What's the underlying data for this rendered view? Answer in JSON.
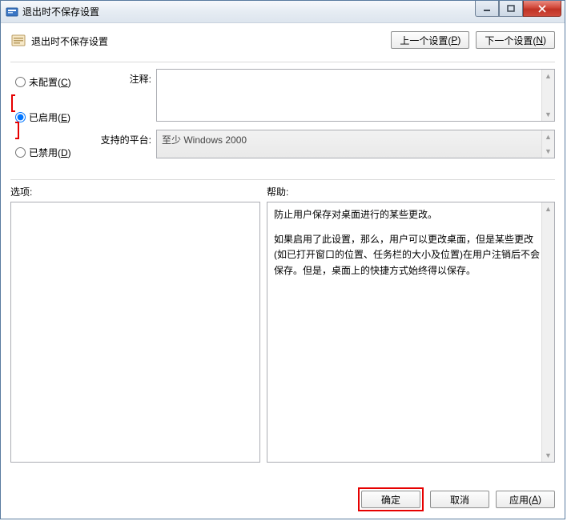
{
  "titlebar": {
    "title": "退出时不保存设置"
  },
  "header": {
    "policy_title": "退出时不保存设置",
    "prev_label": "上一个设置(",
    "prev_key": "P",
    "prev_tail": ")",
    "next_label": "下一个设置(",
    "next_key": "N",
    "next_tail": ")"
  },
  "radio": {
    "not_configured": "未配置(",
    "not_configured_key": "C",
    "enabled": "已启用(",
    "enabled_key": "E",
    "disabled": "已禁用(",
    "disabled_key": "D",
    "tail": ")"
  },
  "fields": {
    "comment_label": "注释:",
    "comment_value": "",
    "platform_label": "支持的平台:",
    "platform_value": "至少 Windows 2000"
  },
  "sections": {
    "options_label": "选项:",
    "help_label": "帮助:"
  },
  "help": {
    "p1": "防止用户保存对桌面进行的某些更改。",
    "p2": "如果启用了此设置，那么，用户可以更改桌面，但是某些更改(如已打开窗口的位置、任务栏的大小及位置)在用户注销后不会保存。但是，桌面上的快捷方式始终得以保存。"
  },
  "buttons": {
    "ok": "确定",
    "cancel": "取消",
    "apply": "应用(",
    "apply_key": "A",
    "apply_tail": ")"
  }
}
